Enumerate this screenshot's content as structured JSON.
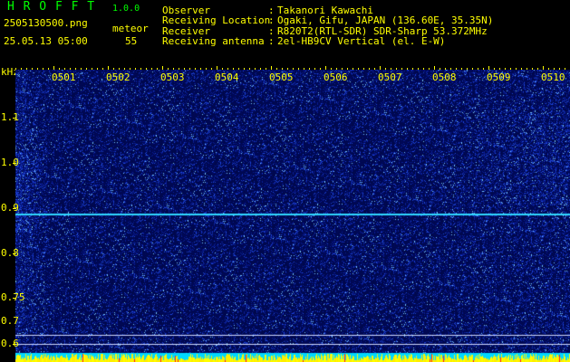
{
  "app": {
    "name": "H R O F F T",
    "version": "1.0.0"
  },
  "file": {
    "name": "2505130500.png",
    "datetime": "25.05.13 05:00"
  },
  "meteor": {
    "label": "meteor",
    "count": "55"
  },
  "info": [
    {
      "key": "Observer",
      "sep": ":",
      "value": "Takanori Kawachi"
    },
    {
      "key": "Receiving Location",
      "sep": ":",
      "value": "Ogaki, Gifu, JAPAN (136.60E, 35.35N)"
    },
    {
      "key": "Receiver",
      "sep": ":",
      "value": "R820T2(RTL-SDR) SDR-Sharp 53.372MHz"
    },
    {
      "key": "Receiving antenna",
      "sep": ":",
      "value": "2el-HB9CV Vertical (el. E-W)"
    }
  ],
  "axis": {
    "y_unit": "kHz",
    "y_ticks": [
      "1.1",
      "1.0",
      "0.9",
      "0.8",
      "0.75",
      "0.7",
      "0.6"
    ],
    "x_ticks": [
      "0501",
      "0502",
      "0503",
      "0504",
      "0505",
      "0506",
      "0507",
      "0508",
      "0509",
      "0510"
    ]
  },
  "colors": {
    "background": "#000000",
    "header_yellow": "#ffff00",
    "title_green": "#00ff00",
    "beacon_line": "#2fd6ff",
    "noise_base": "#000a5a"
  }
}
